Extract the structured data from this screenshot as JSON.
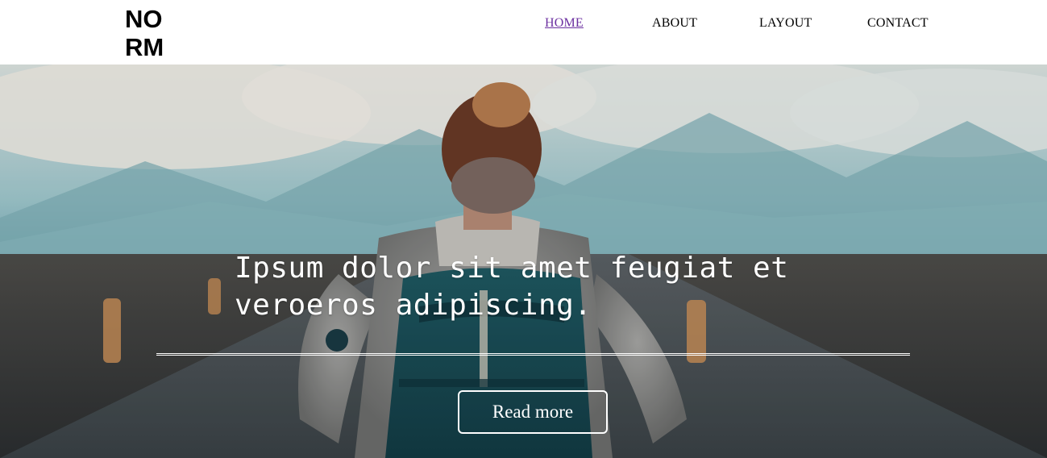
{
  "logo": {
    "line1": "NO",
    "line2": "RM"
  },
  "nav": {
    "items": [
      {
        "label": "HOME",
        "active": true
      },
      {
        "label": "ABOUT",
        "active": false
      },
      {
        "label": "LAYOUT",
        "active": false
      },
      {
        "label": "CONTACT",
        "active": false
      }
    ]
  },
  "hero": {
    "headline_line1": "Ipsum dolor sit amet feugiat et",
    "headline_line2": "veroeros adipiscing.",
    "button_label": "Read more"
  },
  "colors": {
    "active_link": "#6b2fa0",
    "text": "#000000",
    "hero_text": "#ffffff"
  }
}
